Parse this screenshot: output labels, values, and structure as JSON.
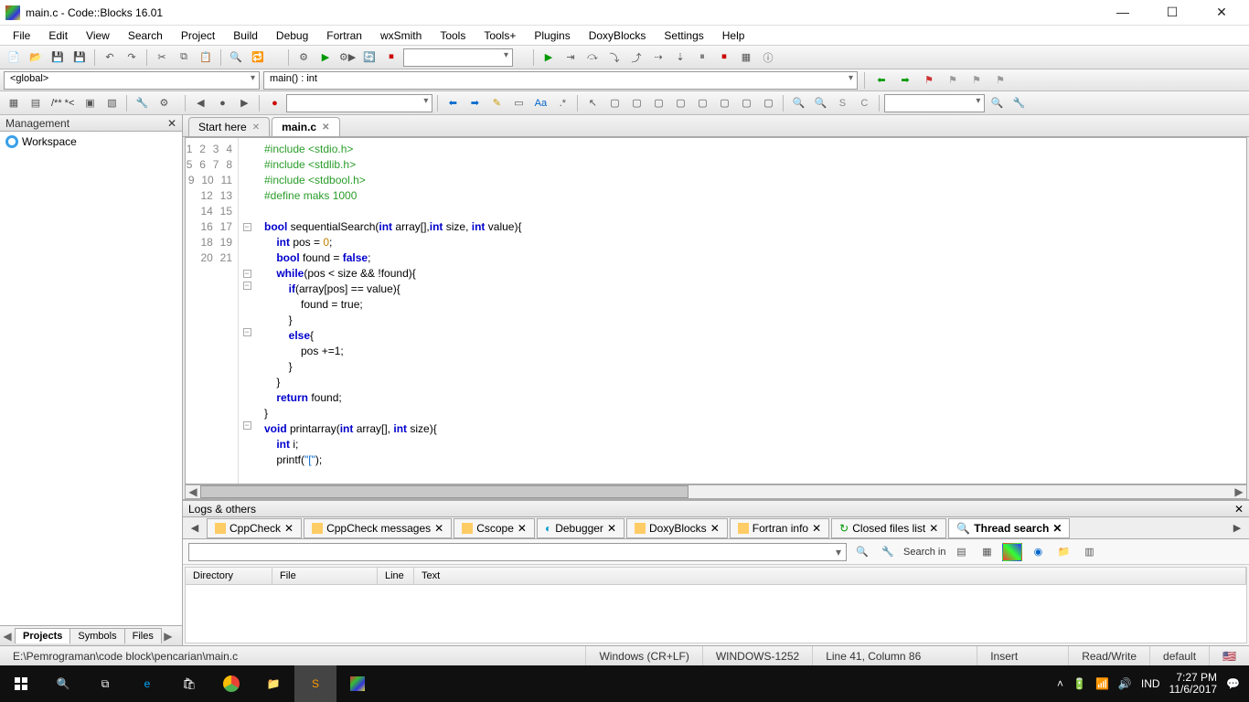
{
  "title": "main.c - Code::Blocks 16.01",
  "menus": [
    "File",
    "Edit",
    "View",
    "Search",
    "Project",
    "Build",
    "Debug",
    "Fortran",
    "wxSmith",
    "Tools",
    "Tools+",
    "Plugins",
    "DoxyBlocks",
    "Settings",
    "Help"
  ],
  "scope": {
    "global": "<global>",
    "func": "main() : int"
  },
  "management": {
    "title": "Management",
    "workspace": "Workspace",
    "tabs": [
      "Projects",
      "Symbols",
      "Files"
    ]
  },
  "editor_tabs": [
    {
      "label": "Start here",
      "active": false
    },
    {
      "label": "main.c",
      "active": true
    }
  ],
  "code_lines": [
    "1",
    "2",
    "3",
    "4",
    "5",
    "6",
    "7",
    "8",
    "9",
    "10",
    "11",
    "12",
    "13",
    "14",
    "15",
    "16",
    "17",
    "18",
    "19",
    "20",
    "21"
  ],
  "code": {
    "l1": "#include <stdio.h>",
    "l2": "#include <stdlib.h>",
    "l3": "#include <stdbool.h>",
    "l4": "#define maks 1000",
    "l5": "",
    "l6a": "bool",
    "l6b": " sequentialSearch(",
    "l6c": "int",
    "l6d": " array[],",
    "l6e": "int",
    "l6f": " size, ",
    "l6g": "int",
    "l6h": " value){",
    "l7a": "    int",
    "l7b": " pos = ",
    "l7c": "0",
    "l7d": ";",
    "l8a": "    bool",
    "l8b": " found = ",
    "l8c": "false",
    "l8d": ";",
    "l9a": "    while",
    "l9b": "(pos < size && !found){",
    "l10a": "        if",
    "l10b": "(array[pos] == value){",
    "l11": "            found = true;",
    "l12": "        }",
    "l13a": "        else",
    "l13b": "{",
    "l14": "            pos +=1;",
    "l15": "        }",
    "l16": "    }",
    "l17a": "    return",
    "l17b": " found;",
    "l18": "}",
    "l19a": "void",
    "l19b": " printarray(",
    "l19c": "int",
    "l19d": " array[], ",
    "l19e": "int",
    "l19f": " size){",
    "l20a": "    int",
    "l20b": " i;",
    "l21a": "    printf(",
    "l21b": "\"[\"",
    "l21c": ");"
  },
  "logs": {
    "title": "Logs & others",
    "tabs": [
      "CppCheck",
      "CppCheck messages",
      "Cscope",
      "Debugger",
      "DoxyBlocks",
      "Fortran info",
      "Closed files list",
      "Thread search"
    ],
    "active_tab": 7,
    "search_label": "Search in",
    "columns": [
      "Directory",
      "File",
      "Line",
      "Text"
    ]
  },
  "status": {
    "path": "E:\\Pemrograman\\code block\\pencarian\\main.c",
    "eol": "Windows (CR+LF)",
    "encoding": "WINDOWS-1252",
    "pos": "Line 41, Column 86",
    "mode": "Insert",
    "access": "Read/Write",
    "profile": "default"
  },
  "taskbar": {
    "lang": "IND",
    "time": "7:27 PM",
    "date": "11/6/2017"
  }
}
